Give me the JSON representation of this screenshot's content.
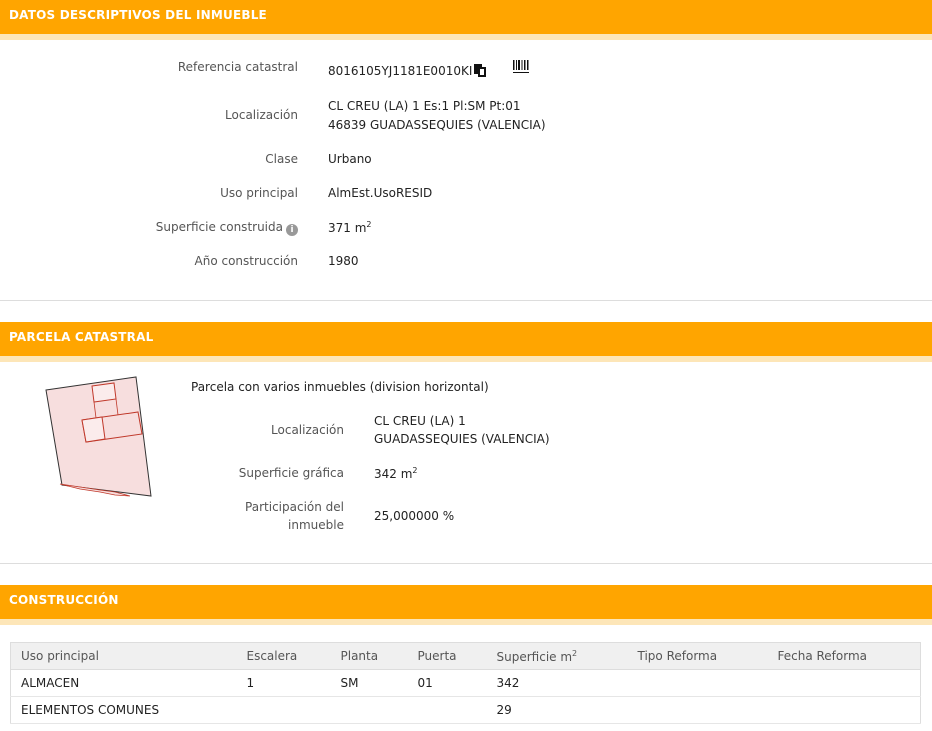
{
  "descriptivos": {
    "header": "DATOS DESCRIPTIVOS DEL INMUEBLE",
    "ref_label": "Referencia catastral",
    "ref_value": "8016105YJ1181E0010KI",
    "loc_label": "Localización",
    "loc_line1": "CL CREU (LA) 1 Es:1 Pl:SM Pt:01",
    "loc_line2": "46839 GUADASSEQUIES (VALENCIA)",
    "clase_label": "Clase",
    "clase_value": "Urbano",
    "uso_label": "Uso principal",
    "uso_value": "AlmEst.UsoRESID",
    "sup_label": "Superficie construida",
    "sup_value": "371 m",
    "sup_unit_exp": "2",
    "anio_label": "Año construcción",
    "anio_value": "1980"
  },
  "parcela": {
    "header": "PARCELA CATASTRAL",
    "title": "Parcela con varios inmuebles (division horizontal)",
    "loc_label": "Localización",
    "loc_line1": "CL CREU (LA) 1",
    "loc_line2": "GUADASSEQUIES (VALENCIA)",
    "sup_label": "Superficie gráfica",
    "sup_value": "342 m",
    "sup_unit_exp": "2",
    "part_label_1": "Participación del",
    "part_label_2": "inmueble",
    "part_value": "25,000000 %"
  },
  "construccion": {
    "header": "CONSTRUCCIÓN",
    "columns": [
      "Uso principal",
      "Escalera",
      "Planta",
      "Puerta",
      "Superficie m",
      "Tipo Reforma",
      "Fecha Reforma"
    ],
    "sup_col_exp": "2",
    "rows": [
      [
        "ALMACEN",
        "1",
        "SM",
        "01",
        "342",
        "",
        ""
      ],
      [
        "ELEMENTOS COMUNES",
        "",
        "",
        "",
        "29",
        "",
        ""
      ]
    ]
  },
  "icons": {
    "info": "info-icon",
    "info_glyph": "i",
    "copy": "copy-icon",
    "barcode": "barcode-icon"
  },
  "colors": {
    "header_bg": "#ffa500",
    "parcel_fill": "#f7dede",
    "parcel_stroke": "#c0392b"
  }
}
